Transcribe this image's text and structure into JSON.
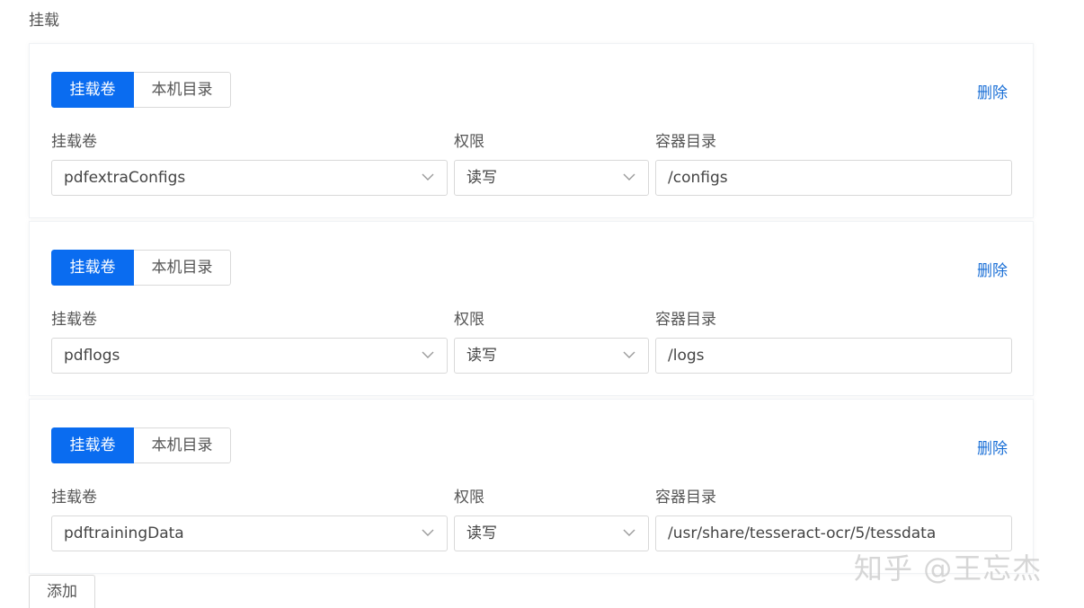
{
  "section": {
    "label": "挂载"
  },
  "mounts": [
    {
      "tabs": [
        "挂载卷",
        "本机目录"
      ],
      "active_tab": "挂载卷",
      "delete_label": "删除",
      "volume_label": "挂载卷",
      "permission_label": "权限",
      "path_label": "容器目录",
      "volume_value": "pdfextraConfigs",
      "permission_value": "读写",
      "path_value": "/configs"
    },
    {
      "tabs": [
        "挂载卷",
        "本机目录"
      ],
      "active_tab": "挂载卷",
      "delete_label": "删除",
      "volume_label": "挂载卷",
      "permission_label": "权限",
      "path_label": "容器目录",
      "volume_value": "pdflogs",
      "permission_value": "读写",
      "path_value": "/logs"
    },
    {
      "tabs": [
        "挂载卷",
        "本机目录"
      ],
      "active_tab": "挂载卷",
      "delete_label": "删除",
      "volume_label": "挂载卷",
      "permission_label": "权限",
      "path_label": "容器目录",
      "volume_value": "pdftrainingData",
      "permission_value": "读写",
      "path_value": "/usr/share/tesseract-ocr/5/tessdata"
    }
  ],
  "add_label": "添加",
  "watermark": "知乎 @王忘杰",
  "colors": {
    "accent": "#0a6cf0",
    "link": "#1a6fd6",
    "border": "#d9d9d9"
  },
  "icons": {
    "select_arrow": "chevron-down-icon"
  }
}
